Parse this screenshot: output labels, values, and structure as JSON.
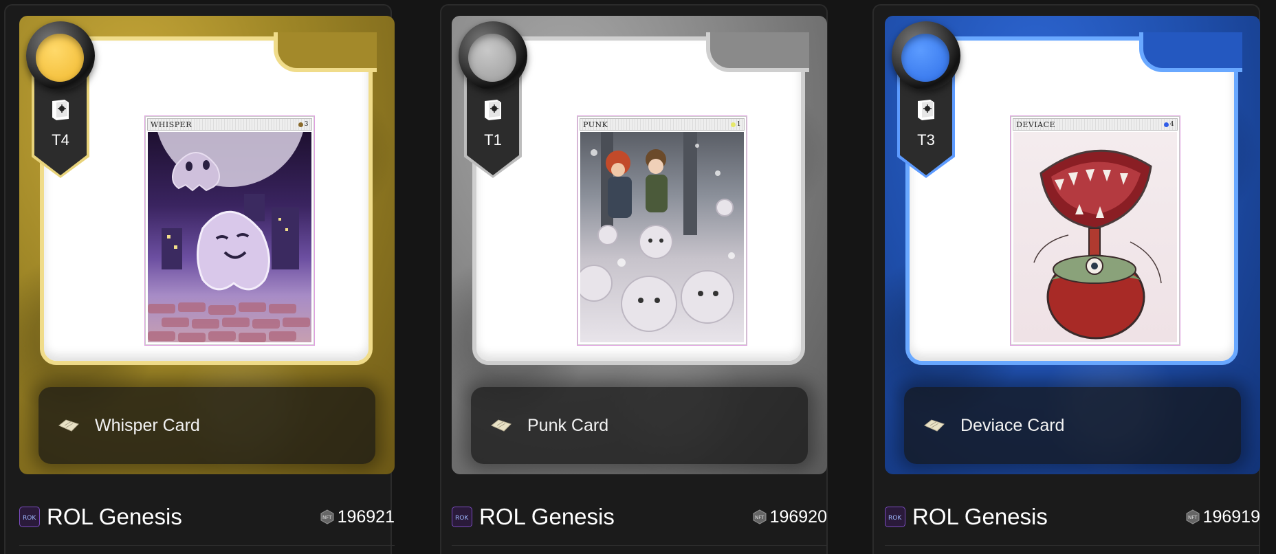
{
  "cards": [
    {
      "theme": "gold",
      "tier": "T4",
      "mini_title": "WHISPER",
      "mini_count": "3",
      "mini_dot_color": "#8a6a2a",
      "name": "Whisper Card",
      "collection": "ROL Genesis",
      "token_id": "196921"
    },
    {
      "theme": "silver",
      "tier": "T1",
      "mini_title": "PUNK",
      "mini_count": "1",
      "mini_dot_color": "#e6e86a",
      "name": "Punk Card",
      "collection": "ROL Genesis",
      "token_id": "196920"
    },
    {
      "theme": "blue",
      "tier": "T3",
      "mini_title": "DEVIACE",
      "mini_count": "4",
      "mini_dot_color": "#2f5ce8",
      "name": "Deviace Card",
      "collection": "ROL Genesis",
      "token_id": "196919"
    }
  ],
  "icons": {
    "tier_badge": "book-icon",
    "card_type": "card-chip-icon",
    "token": "nft-token-icon",
    "collection": "collection-logo-icon"
  },
  "colors": {
    "gold": "#a3892a",
    "silver": "#8a8a8a",
    "blue": "#2458c0",
    "page_bg": "#151515"
  }
}
